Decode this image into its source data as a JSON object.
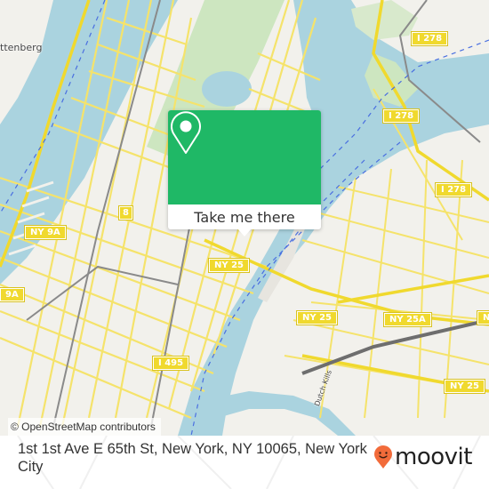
{
  "map": {
    "attribution": "© OpenStreetMap contributors",
    "colors": {
      "water": "#aad3df",
      "land": "#f2f1ec",
      "park": "#cde6c0",
      "road": "#f5e36b",
      "rail": "#8a8a8a",
      "shield": "#f0d92e",
      "popup_green": "#1fb866",
      "brand_orange": "#f26b3a"
    },
    "place_labels": [
      {
        "name": "place-guttenberg",
        "text": "ttenberg"
      }
    ],
    "shields": [
      {
        "name": "shield-i278-top",
        "text": "I 278"
      },
      {
        "name": "shield-i278-mid",
        "text": "I 278"
      },
      {
        "name": "shield-i278-right",
        "text": "I 278"
      },
      {
        "name": "shield-8",
        "text": "8"
      },
      {
        "name": "shield-ny9a-upper",
        "text": "NY 9A"
      },
      {
        "name": "shield-ny9a-lower",
        "text": "9A"
      },
      {
        "name": "shield-ny25-left",
        "text": "NY 25"
      },
      {
        "name": "shield-ny25-mid",
        "text": "NY 25"
      },
      {
        "name": "shield-ny25a",
        "text": "NY 25A"
      },
      {
        "name": "shield-ny25-right",
        "text": "NY 25"
      },
      {
        "name": "shield-i495",
        "text": "I 495"
      },
      {
        "name": "shield-ny-edge",
        "text": "NY"
      }
    ],
    "waterway_label": "Dutch Kills"
  },
  "popup": {
    "icon": "map-pin-icon",
    "button_label": "Take me there"
  },
  "footer": {
    "address": "1st 1st Ave E 65th St, New York, NY 10065, New York City",
    "brand": "moovit",
    "brand_icon": "moovit-smiley-pin-icon"
  }
}
